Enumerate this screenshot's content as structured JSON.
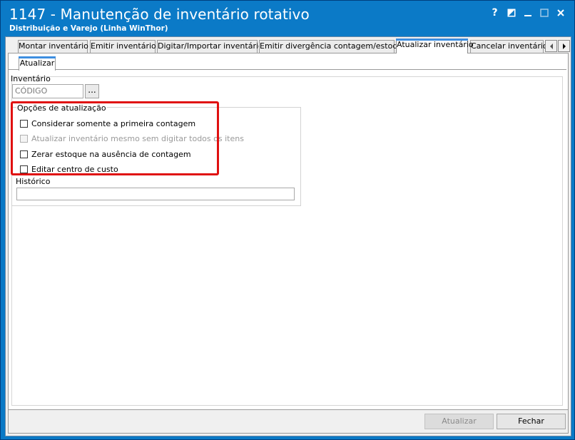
{
  "window": {
    "title": "1147 - Manutenção de inventário rotativo",
    "subtitle": "Distribuição e Varejo (Linha WinThor)",
    "controls": [
      "help-icon",
      "edit-icon",
      "minimize-icon",
      "maximize-icon",
      "close-icon"
    ]
  },
  "tabs": [
    {
      "label": "Montar inventário"
    },
    {
      "label": "Emitir inventário"
    },
    {
      "label": "Digitar/Importar inventário"
    },
    {
      "label": "Emitir divergência contagem/estoque"
    },
    {
      "label": "Atualizar inventário",
      "active": true
    },
    {
      "label": "Cancelar inventário"
    }
  ],
  "inner_tab": {
    "label": "Atualizar"
  },
  "inventario": {
    "label": "Inventário",
    "placeholder": "CÓDIGO",
    "ellipsis": "..."
  },
  "options": {
    "title": "Opções de atualização",
    "items": [
      {
        "label": "Considerar somente a primeira contagem",
        "checked": false,
        "enabled": true
      },
      {
        "label": "Atualizar inventário mesmo sem digitar todos os itens",
        "checked": false,
        "enabled": false
      },
      {
        "label": "Zerar estoque na ausência de contagem",
        "checked": false,
        "enabled": true
      },
      {
        "label": "Editar centro de custo",
        "checked": false,
        "enabled": true
      }
    ]
  },
  "historico": {
    "label": "Histórico",
    "value": ""
  },
  "buttons": {
    "atualizar": "Atualizar",
    "fechar": "Fechar"
  },
  "colors": {
    "titlebar": "#0b7ac7",
    "highlight": "#e01010",
    "accent_tab": "#3d8ee0"
  }
}
